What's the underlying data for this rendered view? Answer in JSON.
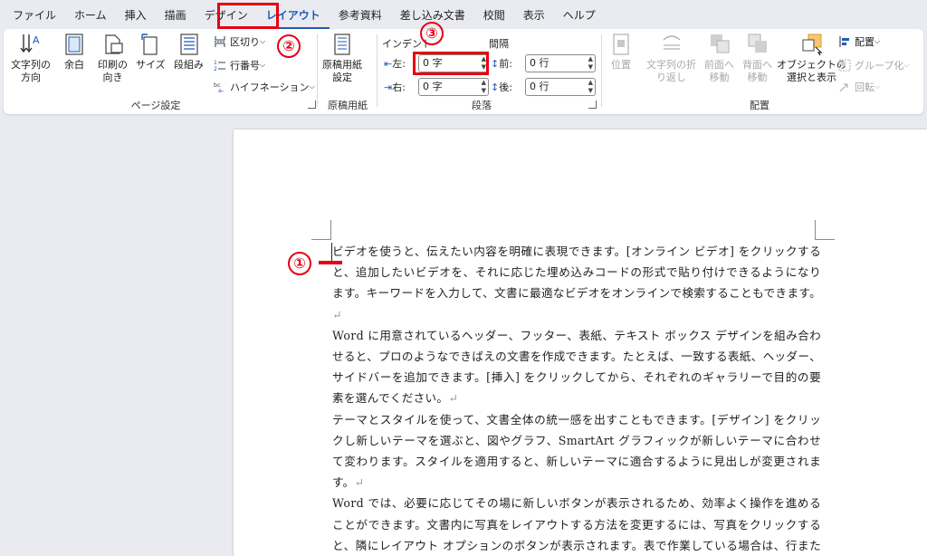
{
  "tabs": [
    {
      "label": "ファイル",
      "active": false
    },
    {
      "label": "ホーム",
      "active": false
    },
    {
      "label": "挿入",
      "active": false
    },
    {
      "label": "描画",
      "active": false
    },
    {
      "label": "デザイン",
      "active": false
    },
    {
      "label": "レイアウト",
      "active": true
    },
    {
      "label": "参考資料",
      "active": false
    },
    {
      "label": "差し込み文書",
      "active": false
    },
    {
      "label": "校閲",
      "active": false
    },
    {
      "label": "表示",
      "active": false
    },
    {
      "label": "ヘルプ",
      "active": false
    }
  ],
  "ribbon": {
    "page_setup": {
      "label": "ページ設定",
      "text_direction": "文字列の\n方向",
      "margins": "余白",
      "orientation": "印刷の\n向き",
      "size": "サイズ",
      "columns": "段組み",
      "breaks": "区切り",
      "line_numbers": "行番号",
      "hyphenation": "ハイフネーション"
    },
    "genko": {
      "label": "原稿用紙",
      "setup": "原稿用紙\n設定"
    },
    "paragraph": {
      "label": "段落",
      "indent_header": "インデント",
      "spacing_header": "間隔",
      "left_label": "左:",
      "right_label": "右:",
      "before_label": "前:",
      "after_label": "後:",
      "left_value": "0 字",
      "right_value": "0 字",
      "before_value": "0 行",
      "after_value": "0 行"
    },
    "arrange": {
      "label": "配置",
      "position": "位置",
      "wrap_text": "文字列の折\nり返し",
      "bring_forward": "前面へ\n移動",
      "send_backward": "背面へ\n移動",
      "selection_pane": "オブジェクトの\n選択と表示",
      "align": "配置",
      "group": "グループ化",
      "rotate": "回転"
    }
  },
  "callouts": {
    "one": "①",
    "two": "②",
    "three": "③"
  },
  "colors": {
    "accent": "#1e5bb8",
    "annotation_red": "#e60012"
  },
  "document": {
    "paragraphs": [
      "ビデオを使うと、伝えたい内容を明確に表現できます。[オンライン ビデオ] をクリックすると、追加したいビデオを、それに応じた埋め込みコードの形式で貼り付けできるようになります。キーワードを入力して、文書に最適なビデオをオンラインで検索することもできます。",
      "Word に用意されているヘッダー、フッター、表紙、テキスト ボックス デザインを組み合わせると、プロのようなできばえの文書を作成できます。たとえば、一致する表紙、ヘッダー、サイドバーを追加できます。[挿入] をクリックしてから、それぞれのギャラリーで目的の要素を選んでください。",
      "テーマとスタイルを使って、文書全体の統一感を出すこともできます。[デザイン] をクリックし新しいテーマを選ぶと、図やグラフ、SmartArt グラフィックが新しいテーマに合わせて変わります。スタイルを適用すると、新しいテーマに適合するように見出しが変更されます。",
      "Word では、必要に応じてその場に新しいボタンが表示されるため、効率よく操作を進めることができます。文書内に写真をレイアウトする方法を変更するには、写真をクリックすると、隣にレイアウト オプションのボタンが表示されます。表で作業している場合は、行または列を追加する場所をクリックして、プラス記号をクリックします。"
    ],
    "paragraph_mark": "↵"
  }
}
